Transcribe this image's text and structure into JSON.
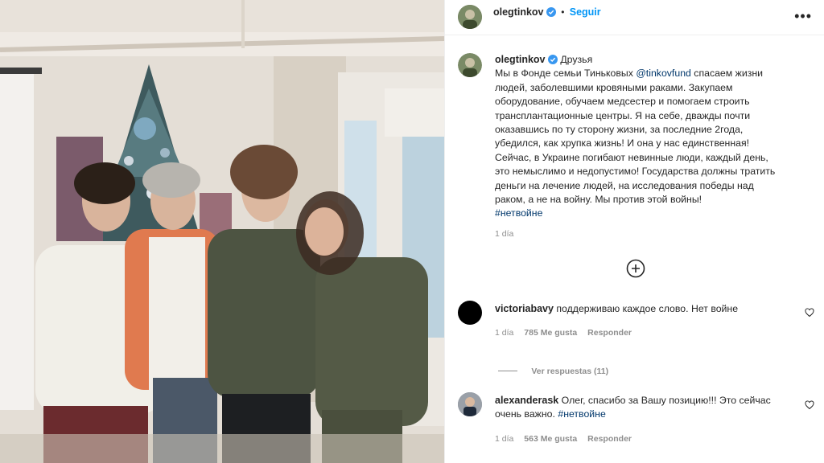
{
  "header": {
    "username": "olegtinkov",
    "follow_label": "Seguir",
    "dot": "•",
    "more": "•••"
  },
  "post": {
    "author": "olegtinkov",
    "location": "Друзья",
    "caption_lines": [
      "Мы в Фонде семьи Тиньковых ",
      "@tinkovfund",
      " спасаем жизни людей, заболевшими кровяными раками. Закупаем оборудование, обучаем медсестер и помогаем строить трансплантационные центры. Я на себе, дважды почти оказавшись по ту сторону жизни, за последние 2года, убедился, как хрупка жизнь! И она у нас единственная! Сейчас, в Украине погибают невинные люди, каждый день, это немыслимо и недопустимо! Государства должны тратить деньги на лечение людей, на исследования победы над раком, а не на войну. Мы против этой войны!"
    ],
    "hashtag": "#нетвойне",
    "time": "1 día"
  },
  "comments": [
    {
      "user": "victoriabavy",
      "text": "поддерживаю каждое слово. Нет войне",
      "time": "1 día",
      "likes": "785 Me gusta",
      "reply": "Responder"
    },
    {
      "user": "alexanderask",
      "text": "Олег, спасибо за Вашу позицию!!! Это сейчас очень важно.",
      "hashtag": "#нетвойне",
      "time": "1 día",
      "likes": "563 Me gusta",
      "reply": "Responder"
    }
  ],
  "replies": {
    "label": "Ver respuestas (11)"
  },
  "colors": {
    "accent": "#0095f6",
    "verified": "#3897f0",
    "link": "#00376b",
    "muted": "#8e8e8e"
  }
}
